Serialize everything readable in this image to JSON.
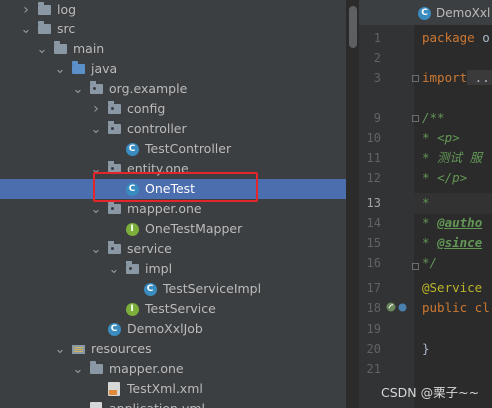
{
  "tree": {
    "items": [
      {
        "label": "log",
        "expanded": false,
        "icon": "folder-icon"
      },
      {
        "label": "src",
        "expanded": true,
        "icon": "folder-icon"
      },
      {
        "label": "main",
        "expanded": true,
        "icon": "folder-icon"
      },
      {
        "label": "java",
        "expanded": true,
        "icon": "source-folder-icon"
      },
      {
        "label": "org.example",
        "expanded": true,
        "icon": "package-icon"
      },
      {
        "label": "config",
        "expanded": false,
        "icon": "package-icon"
      },
      {
        "label": "controller",
        "expanded": true,
        "icon": "package-icon"
      },
      {
        "label": "TestController",
        "icon": "class-icon"
      },
      {
        "label": "entity.one",
        "expanded": true,
        "icon": "package-icon"
      },
      {
        "label": "OneTest",
        "icon": "class-icon",
        "selected": true
      },
      {
        "label": "mapper.one",
        "expanded": true,
        "icon": "package-icon"
      },
      {
        "label": "OneTestMapper",
        "icon": "interface-icon"
      },
      {
        "label": "service",
        "expanded": true,
        "icon": "package-icon"
      },
      {
        "label": "impl",
        "expanded": true,
        "icon": "package-icon"
      },
      {
        "label": "TestServiceImpl",
        "icon": "class-icon"
      },
      {
        "label": "TestService",
        "icon": "interface-icon"
      },
      {
        "label": "DemoXxlJob",
        "icon": "spring-class-icon"
      },
      {
        "label": "resources",
        "expanded": true,
        "icon": "resources-folder-icon"
      },
      {
        "label": "mapper.one",
        "expanded": true,
        "icon": "folder-icon"
      },
      {
        "label": "TestXml.xml",
        "icon": "xml-file-icon"
      },
      {
        "label": "application.yml",
        "icon": "yml-file-icon"
      }
    ]
  },
  "editor": {
    "tab_label": "DemoXxl",
    "line_numbers": [
      "1",
      "2",
      "3",
      "9",
      "10",
      "11",
      "12",
      "13",
      "14",
      "15",
      "16",
      "17",
      "18",
      "19",
      "20",
      "21"
    ],
    "current_line": "13",
    "code": {
      "l1_kw": "package",
      "l1_rest": " o",
      "l3_kw": "import",
      "l3_rest": " ...",
      "l9": "/**",
      "l10_star": " * ",
      "l10_tag": "<p>",
      "l11": " * 测试 服",
      "l12_star": " * ",
      "l12_tag": "</p>",
      "l13": " *",
      "l14_star": " * ",
      "l14_tag": "@autho",
      "l15_star": " * ",
      "l15_tag": "@since",
      "l16": " */",
      "l17": "@Service",
      "l18_kw": "public cl",
      "l20": "}"
    }
  },
  "watermark": "CSDN @栗子~~",
  "colors": {
    "selection": "#4b6eaf",
    "highlight_box": "#e3262c",
    "background": "#2b2b2b"
  }
}
